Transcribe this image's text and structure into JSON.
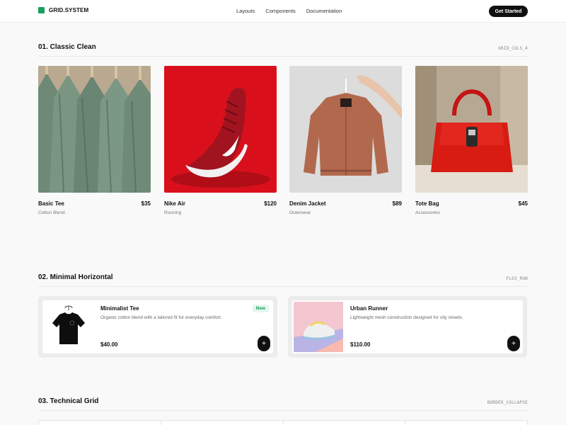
{
  "header": {
    "brand": "GRID.SYSTEM",
    "brand_color": "#17a05d",
    "nav": [
      "Layouts",
      "Components",
      "Documentation"
    ],
    "cta": "Get Started"
  },
  "sections": [
    {
      "title": "01. Classic Clean",
      "tag": "GRID_COLS_4",
      "items": [
        {
          "name": "Basic Tee",
          "price": "$35",
          "category": "Cotton Blend",
          "image": "hanging-tees"
        },
        {
          "name": "Nike Air",
          "price": "$120",
          "category": "Running",
          "image": "red-sneaker"
        },
        {
          "name": "Denim Jacket",
          "price": "$89",
          "category": "Outerwear",
          "image": "hanging-jacket"
        },
        {
          "name": "Tote Bag",
          "price": "$45",
          "category": "Accessories",
          "image": "red-handbag"
        }
      ]
    },
    {
      "title": "02. Minimal Horizontal",
      "tag": "FLEX_ROW",
      "items": [
        {
          "name": "Minimalist Tee",
          "description": "Organic cotton blend with a tailored fit for everyday comfort.",
          "price": "$40.00",
          "badge": "New",
          "image": "black-tee"
        },
        {
          "name": "Urban Runner",
          "description": "Lightweight mesh construction designed for city streets.",
          "price": "$110.00",
          "image": "pastel-sneaker"
        }
      ]
    },
    {
      "title": "03. Technical Grid",
      "tag": "BORDER_COLLAPSE"
    }
  ],
  "icons": {
    "add": "plus-icon"
  },
  "add_symbol": "+"
}
